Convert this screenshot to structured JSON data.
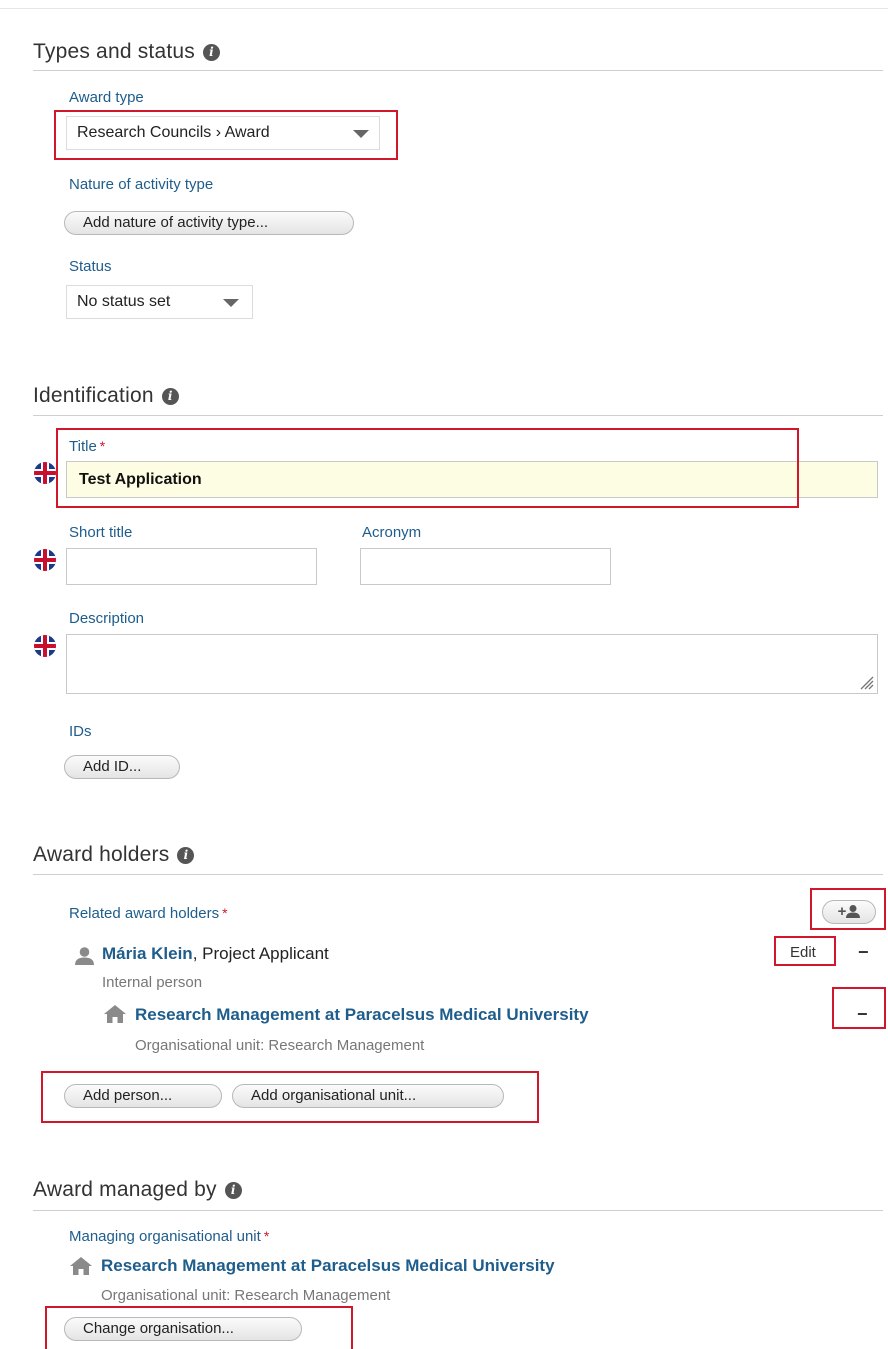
{
  "types_status": {
    "heading": "Types and status",
    "award_type": {
      "label": "Award type",
      "value": "Research Councils › Award"
    },
    "nature": {
      "label": "Nature of activity type",
      "button": "Add nature of activity type..."
    },
    "status": {
      "label": "Status",
      "value": "No status set"
    }
  },
  "identification": {
    "heading": "Identification",
    "title": {
      "label": "Title",
      "required": "*",
      "value": "Test Application"
    },
    "short_title": {
      "label": "Short title",
      "value": ""
    },
    "acronym": {
      "label": "Acronym",
      "value": ""
    },
    "description": {
      "label": "Description",
      "value": ""
    },
    "ids": {
      "label": "IDs",
      "button": "Add ID..."
    }
  },
  "award_holders": {
    "heading": "Award holders",
    "label": "Related award holders",
    "required": "*",
    "person": {
      "name": "Mária Klein",
      "role": ", Project Applicant",
      "type": "Internal person",
      "edit": "Edit",
      "remove": "−"
    },
    "org": {
      "name": "Research Management at Paracelsus Medical University",
      "type": "Organisational unit: Research Management",
      "remove": "−"
    },
    "add_person": "Add person...",
    "add_org": "Add organisational unit...",
    "add_icon_text": "+"
  },
  "managed_by": {
    "heading": "Award managed by",
    "label": "Managing organisational unit",
    "required": "*",
    "org": {
      "name": "Research Management at Paracelsus Medical University",
      "type": "Organisational unit: Research Management"
    },
    "change_button": "Change organisation..."
  },
  "icons": {
    "info": "info-icon",
    "flag": "uk-flag-icon",
    "caret": "dropdown-caret-icon",
    "person": "person-icon",
    "org": "building-icon",
    "add_person": "add-person-icon",
    "resize": "resize-grip-icon"
  }
}
